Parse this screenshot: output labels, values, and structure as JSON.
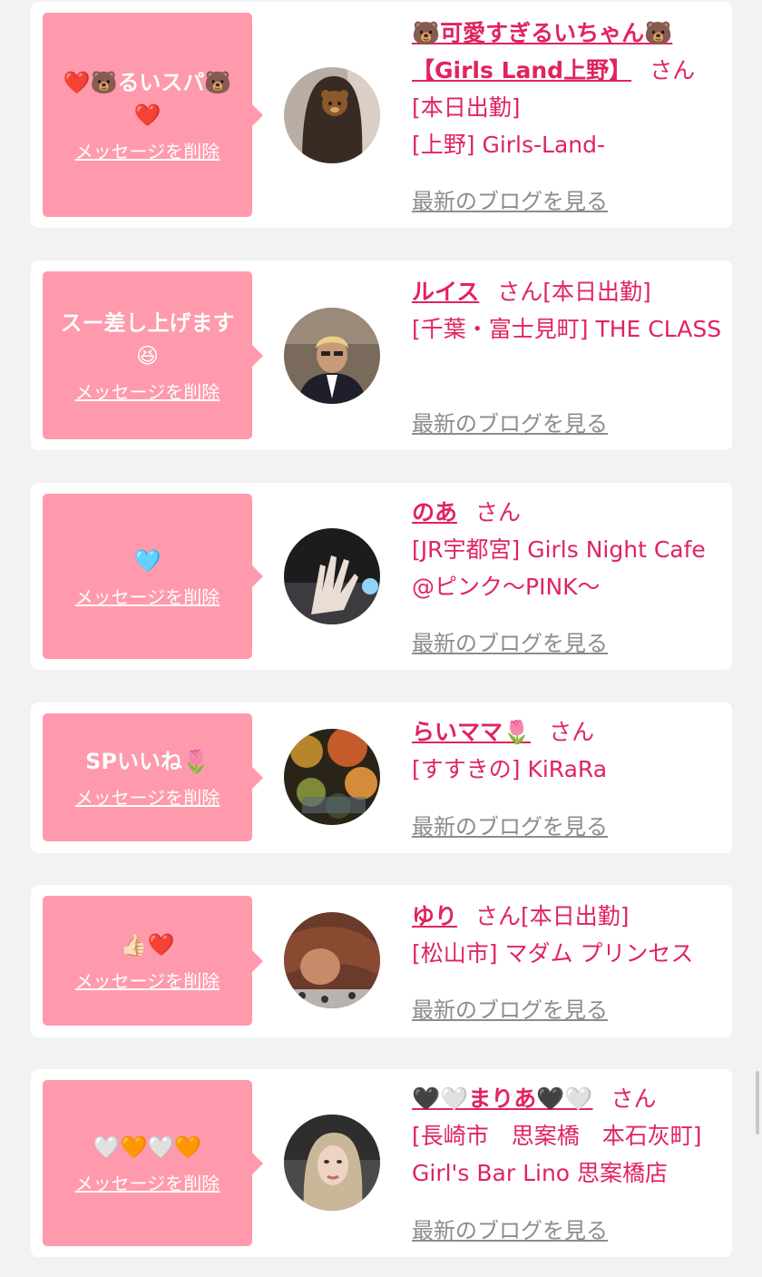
{
  "ui": {
    "delete_label": "メッセージを削除",
    "blog_label": "最新のブログを見る",
    "san": "さん"
  },
  "cards": [
    {
      "bubble_message": "❤️🐻るいスパ🐻❤️",
      "name": "🐻可愛すぎるいちゃん🐻【Girls Land上野】",
      "status": "[本日出勤]",
      "shop": "[上野] Girls-Land-",
      "avatar_icon": "avatar-photo-woman-bear-face"
    },
    {
      "bubble_message": "スー差し上げます😆",
      "name": "ルイス",
      "status": "[本日出勤]",
      "shop": "[千葉・富士見町] THE CLASS",
      "avatar_icon": "avatar-photo-man-suit"
    },
    {
      "bubble_message": "🩵",
      "name": "のあ",
      "status": "",
      "shop": "[JR宇都宮] Girls Night Cafe @ピンク〜PINK〜",
      "avatar_icon": "avatar-photo-hand"
    },
    {
      "bubble_message": "SPいいね🌷",
      "name": "らいママ🌷",
      "status": "",
      "shop": "[すすきの] KiRaRa",
      "avatar_icon": "avatar-photo-autumn-leaves"
    },
    {
      "bubble_message": "👍🏻❤️",
      "name": "ゆり",
      "status": "[本日出勤]",
      "shop": "[松山市] マダム プリンセス",
      "avatar_icon": "avatar-photo-woman-hair"
    },
    {
      "bubble_message": "🤍🧡🤍🧡",
      "name": "🖤🤍まりあ🖤🤍",
      "status": "",
      "shop": "[長崎市　思案橋　本石灰町] Girl's Bar Lino 思案橋店",
      "avatar_icon": "avatar-photo-woman-selfie"
    }
  ]
}
